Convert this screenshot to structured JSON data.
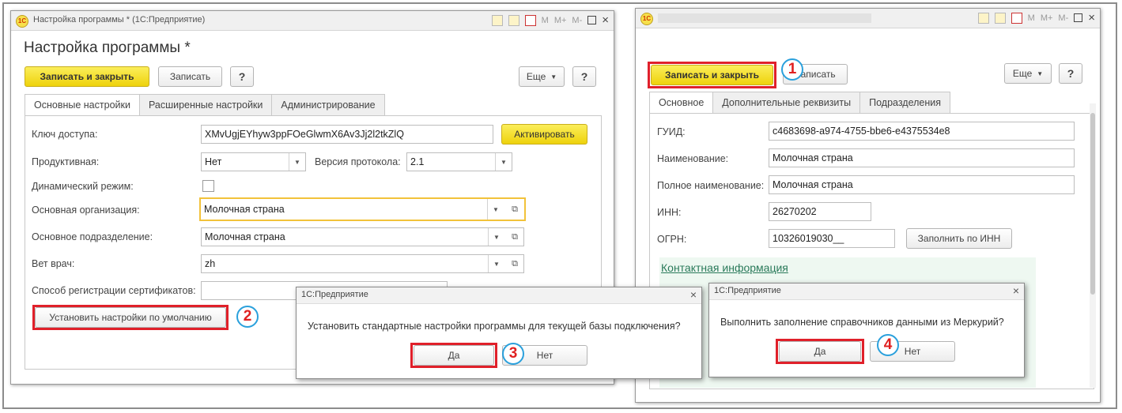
{
  "left_window": {
    "title": "Настройка программы * (1С:Предприятие)",
    "form_title": "Настройка программы *",
    "save_close_label": "Записать и закрыть",
    "save_label": "Записать",
    "help_label": "?",
    "more_label": "Еще",
    "tabs": [
      {
        "label": "Основные настройки"
      },
      {
        "label": "Расширенные настройки"
      },
      {
        "label": "Администрирование"
      }
    ],
    "access_key_label": "Ключ доступа:",
    "access_key_value": "XMvUgjEYhyw3ppFOeGlwmX6Av3Jj2l2tkZlQ",
    "activate_label": "Активировать",
    "productive_label": "Продуктивная:",
    "productive_value": "Нет",
    "protocol_label": "Версия протокола:",
    "protocol_value": "2.1",
    "dynamic_label": "Динамический режим:",
    "org_label": "Основная организация:",
    "org_value": "Молочная страна",
    "dept_label": "Основное подразделение:",
    "dept_value": "Молочная страна",
    "vet_label": "Вет врач:",
    "vet_value": "zh",
    "cert_label": "Способ регистрации сертификатов:",
    "defaults_button": "Установить настройки по умолчанию"
  },
  "right_window": {
    "save_close_label": "Записать и закрыть",
    "save_label": "Записать",
    "more_label": "Еще",
    "help_label": "?",
    "tabs": [
      {
        "label": "Основное"
      },
      {
        "label": "Дополнительные реквизиты"
      },
      {
        "label": "Подразделения"
      }
    ],
    "guid_label": "ГУИД:",
    "guid_value": "c4683698-a974-4755-bbe6-e4375534e8",
    "name_label": "Наименование:",
    "name_value": "Молочная страна",
    "fullname_label": "Полное наименование:",
    "fullname_value": "Молочная страна",
    "inn_label": "ИНН:",
    "inn_value": "26270202",
    "ogrn_label": "ОГРН:",
    "ogrn_value": "10326019030__",
    "fill_inn_button": "Заполнить по ИНН",
    "contact_link": "Контактная информация"
  },
  "titlebar_buttons": {
    "m": "M",
    "m_plus": "M+",
    "m_minus": "M-",
    "close": "×"
  },
  "dialog1": {
    "title": "1С:Предприятие",
    "message": "Установить стандартные настройки программы для текущей базы подключения?",
    "yes": "Да",
    "no": "Нет"
  },
  "dialog2": {
    "title": "1С:Предприятие",
    "message": "Выполнить заполнение справочников данными из Меркурий?",
    "yes": "Да",
    "no": "Нет"
  },
  "step_markers": [
    "1",
    "2",
    "3",
    "4"
  ],
  "colors": {
    "highlight_red": "#e0202a",
    "marker_blue": "#2aa0dc",
    "button_yellow": "#f5e233"
  }
}
